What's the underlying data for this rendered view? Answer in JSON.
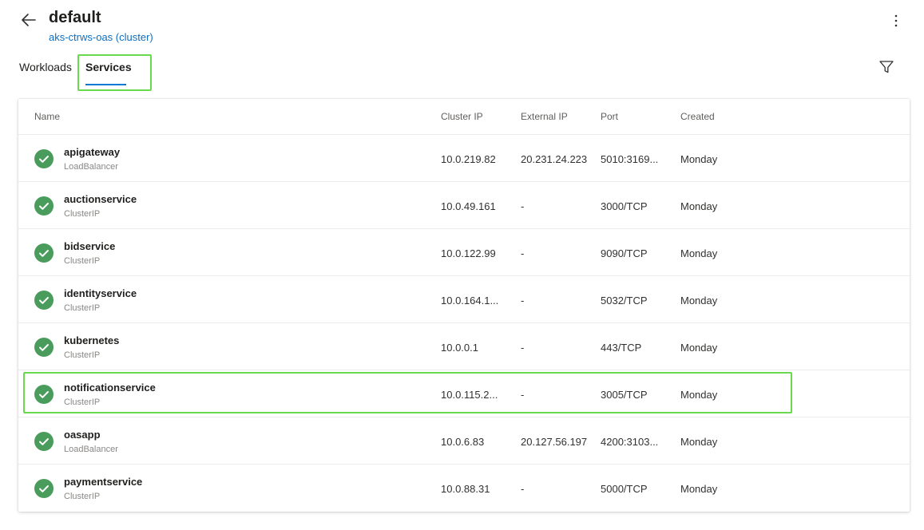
{
  "header": {
    "title": "default",
    "subtitle": "aks-ctrws-oas (cluster)"
  },
  "tabs": [
    {
      "label": "Workloads",
      "selected": false
    },
    {
      "label": "Services",
      "selected": true
    }
  ],
  "table": {
    "columns": [
      "Name",
      "Cluster IP",
      "External IP",
      "Port",
      "Created"
    ],
    "rows": [
      {
        "name": "apigateway",
        "type": "LoadBalancer",
        "cluster_ip": "10.0.219.82",
        "external_ip": "20.231.24.223",
        "port": "5010:3169...",
        "created": "Monday"
      },
      {
        "name": "auctionservice",
        "type": "ClusterIP",
        "cluster_ip": "10.0.49.161",
        "external_ip": "-",
        "port": "3000/TCP",
        "created": "Monday"
      },
      {
        "name": "bidservice",
        "type": "ClusterIP",
        "cluster_ip": "10.0.122.99",
        "external_ip": "-",
        "port": "9090/TCP",
        "created": "Monday"
      },
      {
        "name": "identityservice",
        "type": "ClusterIP",
        "cluster_ip": "10.0.164.1...",
        "external_ip": "-",
        "port": "5032/TCP",
        "created": "Monday"
      },
      {
        "name": "kubernetes",
        "type": "ClusterIP",
        "cluster_ip": "10.0.0.1",
        "external_ip": "-",
        "port": "443/TCP",
        "created": "Monday"
      },
      {
        "name": "notificationservice",
        "type": "ClusterIP",
        "cluster_ip": "10.0.115.2...",
        "external_ip": "-",
        "port": "3005/TCP",
        "created": "Monday"
      },
      {
        "name": "oasapp",
        "type": "LoadBalancer",
        "cluster_ip": "10.0.6.83",
        "external_ip": "20.127.56.197",
        "port": "4200:3103...",
        "created": "Monday"
      },
      {
        "name": "paymentservice",
        "type": "ClusterIP",
        "cluster_ip": "10.0.88.31",
        "external_ip": "-",
        "port": "5000/TCP",
        "created": "Monday"
      }
    ]
  },
  "icons": {
    "back": "arrow-left-icon",
    "more": "more-vertical-icon",
    "filter": "filter-icon",
    "status": "check-circle-icon"
  },
  "colors": {
    "accent": "#0078d4",
    "link": "#106ebe",
    "status_ok": "#4a9c5d",
    "highlight": "#6bd94e"
  }
}
